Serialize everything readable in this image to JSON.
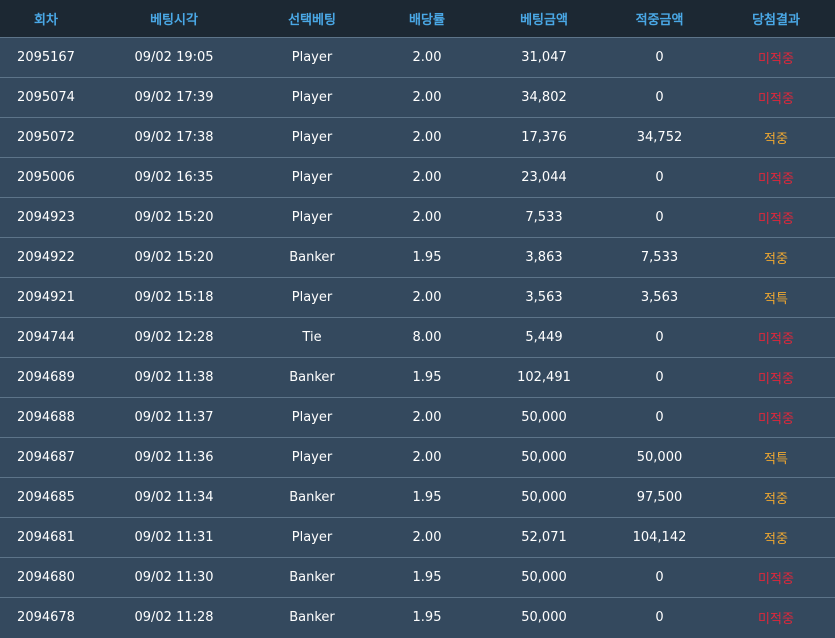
{
  "columns": {
    "round": "회차",
    "time": "베팅시각",
    "pick": "선택베팅",
    "odds": "배당률",
    "bet_amount": "베팅금액",
    "win_amount": "적중금액",
    "result": "당첨결과"
  },
  "status_colors": {
    "lose": "#e0273a",
    "win": "#f0a830"
  },
  "rows": [
    {
      "round": "2095167",
      "time": "09/02 19:05",
      "pick": "Player",
      "odds": "2.00",
      "bet": "31,047",
      "win": "0",
      "result": "미적중",
      "status": "lose"
    },
    {
      "round": "2095074",
      "time": "09/02 17:39",
      "pick": "Player",
      "odds": "2.00",
      "bet": "34,802",
      "win": "0",
      "result": "미적중",
      "status": "lose"
    },
    {
      "round": "2095072",
      "time": "09/02 17:38",
      "pick": "Player",
      "odds": "2.00",
      "bet": "17,376",
      "win": "34,752",
      "result": "적중",
      "status": "win"
    },
    {
      "round": "2095006",
      "time": "09/02 16:35",
      "pick": "Player",
      "odds": "2.00",
      "bet": "23,044",
      "win": "0",
      "result": "미적중",
      "status": "lose"
    },
    {
      "round": "2094923",
      "time": "09/02 15:20",
      "pick": "Player",
      "odds": "2.00",
      "bet": "7,533",
      "win": "0",
      "result": "미적중",
      "status": "lose"
    },
    {
      "round": "2094922",
      "time": "09/02 15:20",
      "pick": "Banker",
      "odds": "1.95",
      "bet": "3,863",
      "win": "7,533",
      "result": "적중",
      "status": "win"
    },
    {
      "round": "2094921",
      "time": "09/02 15:18",
      "pick": "Player",
      "odds": "2.00",
      "bet": "3,563",
      "win": "3,563",
      "result": "적특",
      "status": "win"
    },
    {
      "round": "2094744",
      "time": "09/02 12:28",
      "pick": "Tie",
      "odds": "8.00",
      "bet": "5,449",
      "win": "0",
      "result": "미적중",
      "status": "lose"
    },
    {
      "round": "2094689",
      "time": "09/02 11:38",
      "pick": "Banker",
      "odds": "1.95",
      "bet": "102,491",
      "win": "0",
      "result": "미적중",
      "status": "lose"
    },
    {
      "round": "2094688",
      "time": "09/02 11:37",
      "pick": "Player",
      "odds": "2.00",
      "bet": "50,000",
      "win": "0",
      "result": "미적중",
      "status": "lose"
    },
    {
      "round": "2094687",
      "time": "09/02 11:36",
      "pick": "Player",
      "odds": "2.00",
      "bet": "50,000",
      "win": "50,000",
      "result": "적특",
      "status": "win"
    },
    {
      "round": "2094685",
      "time": "09/02 11:34",
      "pick": "Banker",
      "odds": "1.95",
      "bet": "50,000",
      "win": "97,500",
      "result": "적중",
      "status": "win"
    },
    {
      "round": "2094681",
      "time": "09/02 11:31",
      "pick": "Player",
      "odds": "2.00",
      "bet": "52,071",
      "win": "104,142",
      "result": "적중",
      "status": "win"
    },
    {
      "round": "2094680",
      "time": "09/02 11:30",
      "pick": "Banker",
      "odds": "1.95",
      "bet": "50,000",
      "win": "0",
      "result": "미적중",
      "status": "lose"
    },
    {
      "round": "2094678",
      "time": "09/02 11:28",
      "pick": "Banker",
      "odds": "1.95",
      "bet": "50,000",
      "win": "0",
      "result": "미적중",
      "status": "lose"
    }
  ]
}
